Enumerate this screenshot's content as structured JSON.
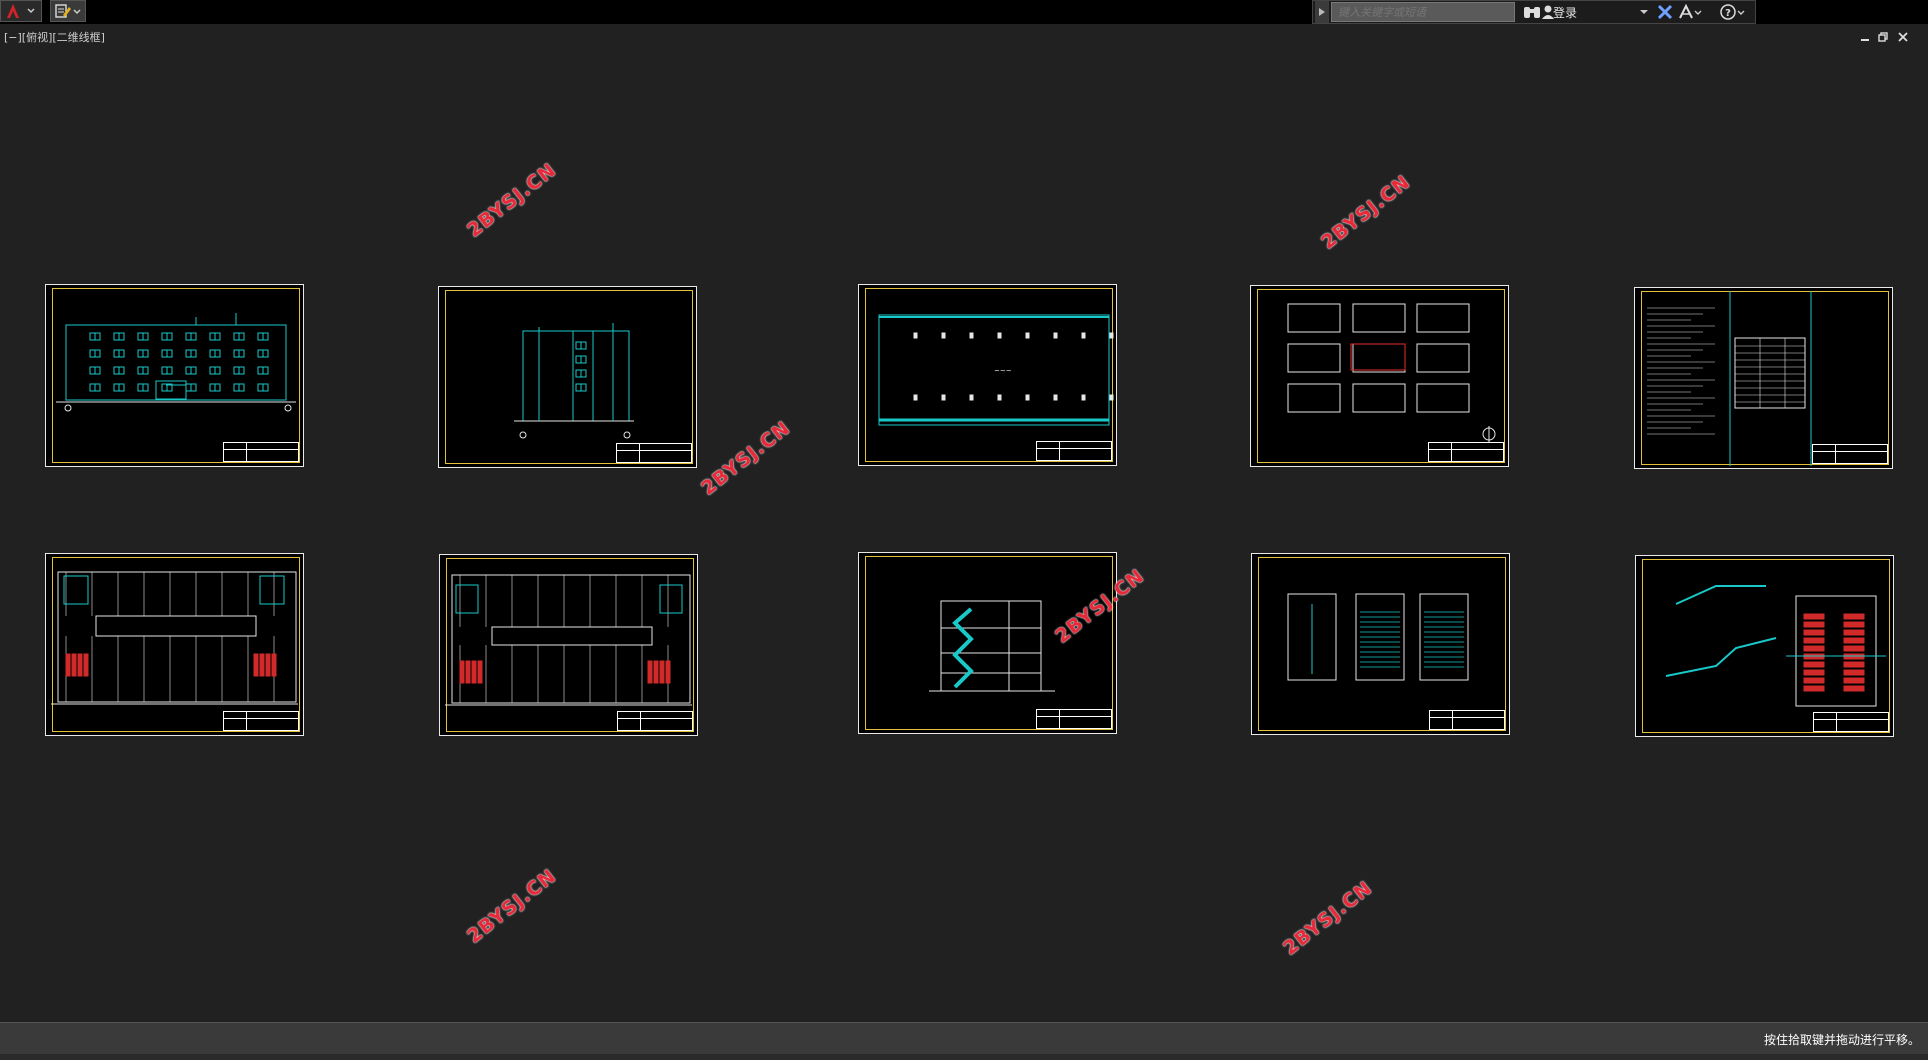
{
  "toolbar": {
    "app_menu_icon": "autocad-a-icon",
    "quick_tool_icon": "save-edit-icon"
  },
  "search": {
    "placeholder": "键入关键字或短语",
    "login_label": "登录"
  },
  "viewport": {
    "label": "[−][俯视][二维线框]"
  },
  "sheets": [
    {
      "id": "elevation-front"
    },
    {
      "id": "elevation-side"
    },
    {
      "id": "roof-plan"
    },
    {
      "id": "site-plan"
    },
    {
      "id": "notes-sheet"
    },
    {
      "id": "floor-plan-1"
    },
    {
      "id": "floor-plan-2"
    },
    {
      "id": "section-1-1"
    },
    {
      "id": "stair-plans"
    },
    {
      "id": "stair-details"
    }
  ],
  "watermarks": [
    "2BYSJ.CN",
    "2BYSJ.CN",
    "2BYSJ.CN",
    "2BYSJ.CN",
    "2BYSJ.CN",
    "2BYSJ.CN"
  ],
  "status": {
    "message": "按住拾取键并拖动进行平移。"
  },
  "colors": {
    "background": "#212121",
    "frame": "#e2c23a",
    "linework": "#19c9c9",
    "watermark": "#e8293a"
  }
}
